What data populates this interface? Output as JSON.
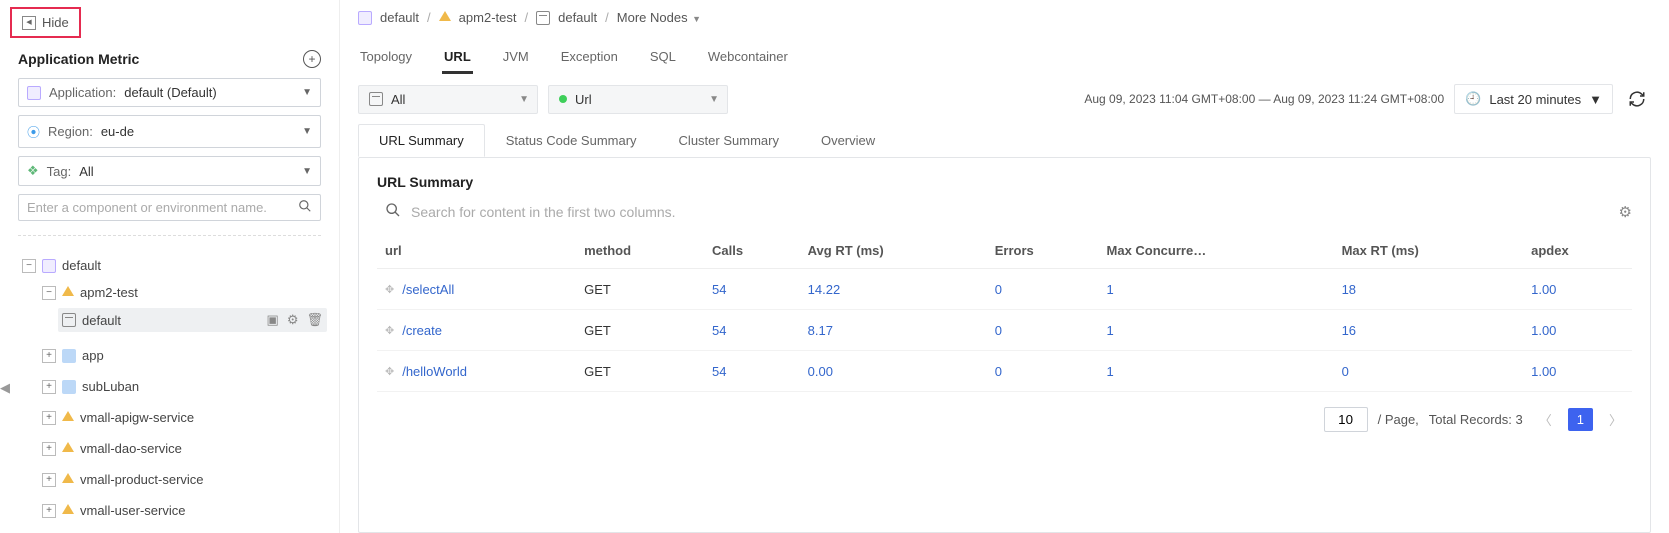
{
  "sidebar": {
    "hide_label": "Hide",
    "title": "Application Metric",
    "filters": {
      "application": {
        "label": "Application:",
        "value": "default (Default)"
      },
      "region": {
        "label": "Region:",
        "value": "eu-de"
      },
      "tag": {
        "label": "Tag:",
        "value": "All"
      }
    },
    "search_placeholder": "Enter a component or environment name.",
    "tree": {
      "root": {
        "label": "default"
      },
      "apm2": {
        "label": "apm2-test"
      },
      "env_default": {
        "label": "default"
      },
      "items": [
        {
          "label": "app"
        },
        {
          "label": "subLuban"
        },
        {
          "label": "vmall-apigw-service"
        },
        {
          "label": "vmall-dao-service"
        },
        {
          "label": "vmall-product-service"
        },
        {
          "label": "vmall-user-service"
        }
      ]
    }
  },
  "breadcrumb": {
    "a": "default",
    "b": "apm2-test",
    "c": "default",
    "d": "More Nodes"
  },
  "tabs": [
    "Topology",
    "URL",
    "JVM",
    "Exception",
    "SQL",
    "Webcontainer"
  ],
  "active_tab": "URL",
  "env_filter": {
    "value": "All"
  },
  "url_filter": {
    "value": "Url"
  },
  "time": {
    "range_text": "Aug 09, 2023 11:04 GMT+08:00 — Aug 09, 2023 11:24 GMT+08:00",
    "preset": "Last 20 minutes"
  },
  "subtabs": [
    "URL Summary",
    "Status Code Summary",
    "Cluster Summary",
    "Overview"
  ],
  "active_subtab": "URL Summary",
  "section_title": "URL Summary",
  "table_search_placeholder": "Search for content in the first two columns.",
  "columns": [
    "url",
    "method",
    "Calls",
    "Avg RT (ms)",
    "Errors",
    "Max Concurre…",
    "Max RT (ms)",
    "apdex"
  ],
  "rows": [
    {
      "url": "/selectAll",
      "method": "GET",
      "calls": "54",
      "avg_rt": "14.22",
      "errors": "0",
      "max_conc": "1",
      "max_rt": "18",
      "apdex": "1.00"
    },
    {
      "url": "/create",
      "method": "GET",
      "calls": "54",
      "avg_rt": "8.17",
      "errors": "0",
      "max_conc": "1",
      "max_rt": "16",
      "apdex": "1.00"
    },
    {
      "url": "/helloWorld",
      "method": "GET",
      "calls": "54",
      "avg_rt": "0.00",
      "errors": "0",
      "max_conc": "1",
      "max_rt": "0",
      "apdex": "1.00"
    }
  ],
  "pager": {
    "page_size": "10",
    "per_page_label": "/ Page,",
    "total_label": "Total Records: 3",
    "current": "1"
  }
}
